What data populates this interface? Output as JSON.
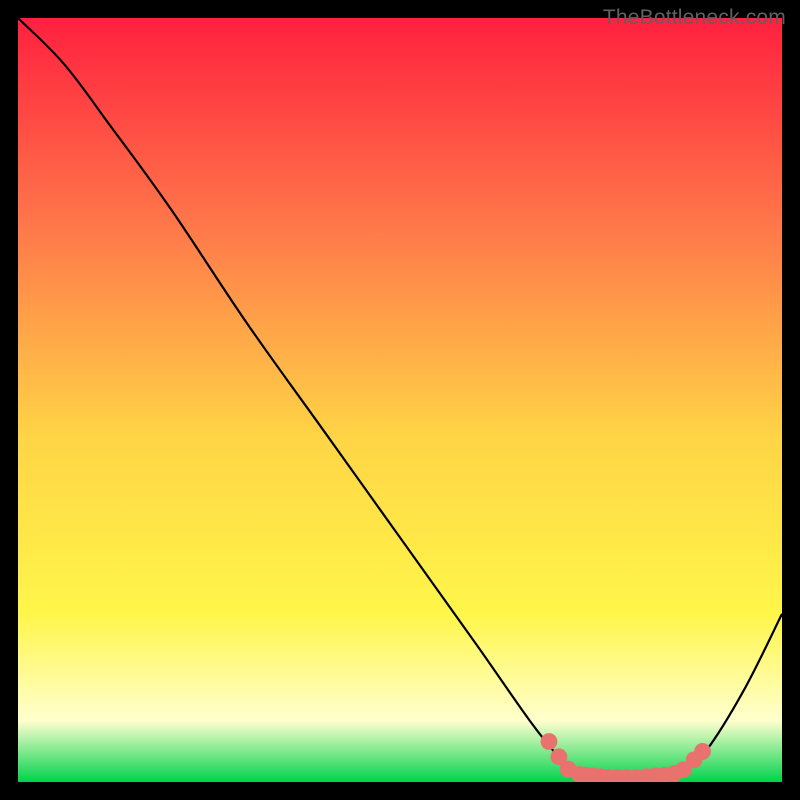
{
  "watermark": "TheBottleneck.com",
  "colors": {
    "gradient_top": "#FF203F",
    "gradient_mid_upper": "#FF7A4A",
    "gradient_mid": "#FFD546",
    "gradient_mid_lower": "#FFF64A",
    "gradient_bottom_low": "#FFFFCE",
    "gradient_bottom": "#00D34D",
    "curve": "#000000",
    "marker": "#E9726F",
    "page_bg": "#000000"
  },
  "chart_data": {
    "type": "line",
    "title": "",
    "xlabel": "",
    "ylabel": "",
    "xlim": [
      0,
      100
    ],
    "ylim": [
      0,
      100
    ],
    "grid": false,
    "legend": false,
    "curve_points": [
      {
        "x": 0,
        "y": 100
      },
      {
        "x": 6,
        "y": 94
      },
      {
        "x": 12,
        "y": 86
      },
      {
        "x": 20,
        "y": 75
      },
      {
        "x": 30,
        "y": 60
      },
      {
        "x": 40,
        "y": 46
      },
      {
        "x": 50,
        "y": 32
      },
      {
        "x": 60,
        "y": 18
      },
      {
        "x": 67,
        "y": 8
      },
      {
        "x": 71,
        "y": 3
      },
      {
        "x": 73,
        "y": 1.2
      },
      {
        "x": 76,
        "y": 0.4
      },
      {
        "x": 80,
        "y": 0.3
      },
      {
        "x": 84,
        "y": 0.5
      },
      {
        "x": 87,
        "y": 1.5
      },
      {
        "x": 90,
        "y": 4
      },
      {
        "x": 95,
        "y": 12
      },
      {
        "x": 100,
        "y": 22
      }
    ],
    "markers": [
      {
        "x": 69.5,
        "y": 5.3
      },
      {
        "x": 70.8,
        "y": 3.3
      },
      {
        "x": 72.0,
        "y": 1.7
      },
      {
        "x": 73.5,
        "y": 1.0
      },
      {
        "x": 74.3,
        "y": 0.9
      },
      {
        "x": 75.2,
        "y": 0.8
      },
      {
        "x": 76.2,
        "y": 0.7
      },
      {
        "x": 77.3,
        "y": 0.6
      },
      {
        "x": 78.5,
        "y": 0.6
      },
      {
        "x": 79.7,
        "y": 0.6
      },
      {
        "x": 81.0,
        "y": 0.6
      },
      {
        "x": 82.3,
        "y": 0.7
      },
      {
        "x": 83.5,
        "y": 0.8
      },
      {
        "x": 84.7,
        "y": 0.9
      },
      {
        "x": 85.9,
        "y": 1.1
      },
      {
        "x": 87.1,
        "y": 1.6
      },
      {
        "x": 88.5,
        "y": 2.9
      },
      {
        "x": 89.6,
        "y": 4.0
      }
    ],
    "marker_radius": 1.1
  }
}
